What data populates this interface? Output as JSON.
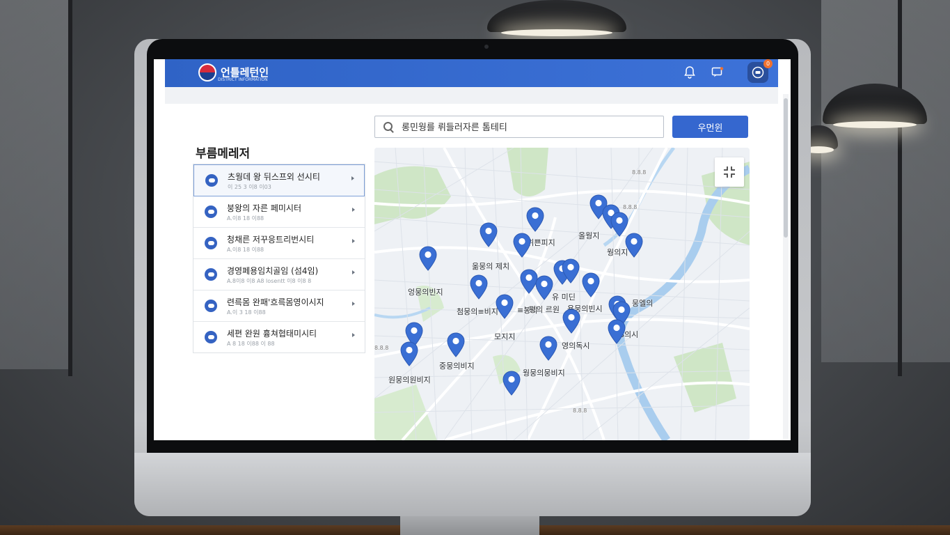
{
  "header": {
    "logo_text": "언틀레턴인",
    "logo_sub": "DISTRICT INFORMATION",
    "profile_badge": "0"
  },
  "sidebar": {
    "title": "부름메레저",
    "items": [
      {
        "name": "츠웡데 왕 뒤스프외 선시티",
        "addr": "이 25 3 이8 이03"
      },
      {
        "name": "붕왕의 자른 페미시터",
        "addr": "A.이8 18 이88"
      },
      {
        "name": "청채른 저꾸응트리번시티",
        "addr": "A.이8 18 이88"
      },
      {
        "name": "경영페용임치골임 (섬4임)",
        "addr": "A.8이8 이8 A8 losentt 이8 이8 8"
      },
      {
        "name": "련륵몸 완패'흐륵몸영이시지",
        "addr": "A.이 3 18 이88"
      },
      {
        "name": "세편 완원 흉쳐협태미시티",
        "addr": "A 8 18 이88 이 88"
      }
    ]
  },
  "search": {
    "placeholder": "롱민웡를 뤼들러자른 톰테티",
    "button_label": "우먼윈"
  },
  "map": {
    "labels": [
      {
        "text": "월뭉위쁜피지"
      },
      {
        "text": "옮뭉의 제치"
      },
      {
        "text": "엉뭉의빈지"
      },
      {
        "text": "첨뭉의≡비지"
      },
      {
        "text": "≡봉의"
      },
      {
        "text": "평의 르원"
      },
      {
        "text": "유 미딘"
      },
      {
        "text": "용뭉의빈시"
      },
      {
        "text": "모지지"
      },
      {
        "text": "영의독시"
      },
      {
        "text": "중뭉의비지"
      },
      {
        "text": "웡뭉의뭉비지"
      },
      {
        "text": "원뭉의원비지"
      },
      {
        "text": "올웡지"
      },
      {
        "text": "웡의지"
      },
      {
        "text": "8의시"
      },
      {
        "text": "뭉엘의"
      },
      {
        "text": "8.8.8"
      },
      {
        "text": "8.8.8"
      },
      {
        "text": "8.8.8"
      },
      {
        "text": "8.8.8"
      }
    ]
  },
  "colors": {
    "primary": "#3567cf",
    "pin": "#3a6fd4",
    "water": "#a9cdee",
    "park": "#bfe0b5"
  }
}
